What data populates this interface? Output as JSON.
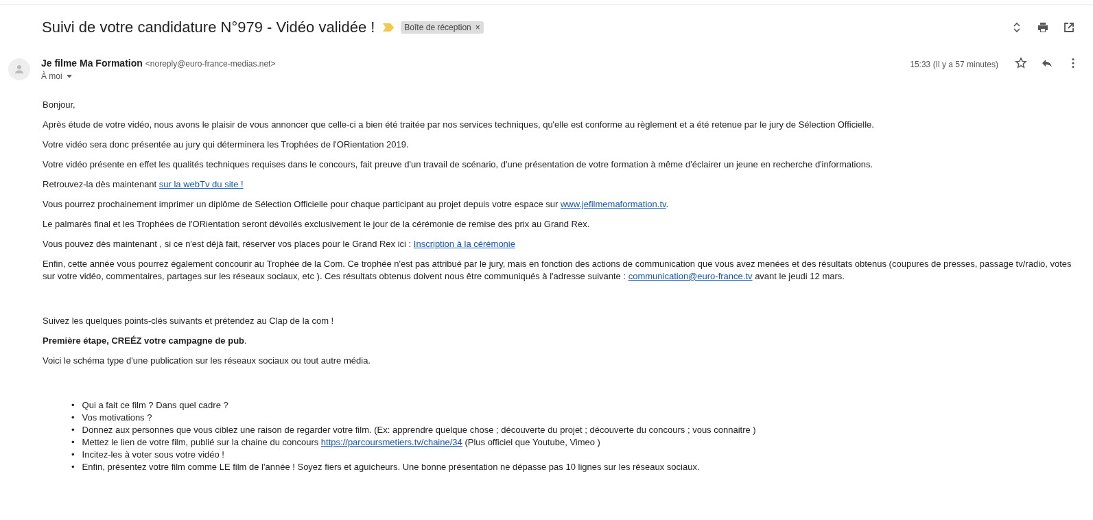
{
  "subject": "Suivi de votre candidature N°979 - Vidéo validée !",
  "important": true,
  "label": {
    "text": "Boîte de réception",
    "close": "×"
  },
  "sender": {
    "name": "Je filme Ma Formation",
    "email": "<noreply@euro-france-medias.net>",
    "to": "À moi",
    "time": "15:33 (Il y a 57 minutes)",
    "starred": false
  },
  "paragraphs": [
    {
      "parts": [
        {
          "kind": "text",
          "text": "Bonjour,"
        }
      ]
    },
    {
      "parts": [
        {
          "kind": "text",
          "text": "Après étude de votre vidéo, nous avons le plaisir de vous annoncer que celle-ci a bien été traitée par nos services techniques, qu'elle est conforme au règlement et a été retenue  par le jury de Sélection Officielle."
        }
      ]
    },
    {
      "parts": [
        {
          "kind": "text",
          "text": "Votre vidéo sera donc  présentée au jury qui déterminera les Trophées de l'ORientation 2019."
        }
      ]
    },
    {
      "parts": [
        {
          "kind": "text",
          "text": "Votre vidéo présente en effet les qualités techniques requises dans le concours, fait preuve d'un travail de scénario, d'une présentation de votre formation à même d'éclairer un jeune en recherche d'informations."
        }
      ]
    },
    {
      "parts": [
        {
          "kind": "text",
          "text": "Retrouvez-la dès maintenant "
        },
        {
          "kind": "link",
          "text": "sur la webTv du site !"
        }
      ]
    },
    {
      "parts": [
        {
          "kind": "text",
          "text": "Vous pourrez prochainement imprimer un diplôme de Sélection Officielle pour chaque participant  au projet  depuis votre espace sur "
        },
        {
          "kind": "link",
          "text": "www.jefilmemaformation.tv"
        },
        {
          "kind": "text",
          "text": "."
        }
      ]
    },
    {
      "parts": [
        {
          "kind": "text",
          "text": "Le palmarès final et les Trophées de l'ORientation  seront dévoilés exclusivement le jour de la cérémonie de remise des prix au Grand Rex."
        }
      ]
    },
    {
      "parts": [
        {
          "kind": "text",
          "text": "Vous pouvez dès maintenant , si ce n'est déjà fait,  réserver vos places pour le Grand Rex ici : "
        },
        {
          "kind": "link",
          "text": "Inscription à la cérémonie"
        }
      ]
    },
    {
      "parts": [
        {
          "kind": "text",
          "text": "Enfin, cette année vous pourrez également concourir au Trophée de la Com. Ce trophée n'est pas attribué par le jury, mais en fonction des actions de communication que vous avez menées et des résultats obtenus (coupures de presses, passage tv/radio, votes sur votre vidéo, commentaires, partages sur les réseaux sociaux, etc ). Ces résultats obtenus doivent nous être communiqués à l'adresse suivante : "
        },
        {
          "kind": "link",
          "text": "communication@euro-france.tv"
        },
        {
          "kind": "text",
          "text": " avant le jeudi 12 mars."
        }
      ]
    }
  ],
  "paragraphs_2": [
    {
      "parts": [
        {
          "kind": "text",
          "text": "Suivez les quelques points-clés suivants et prétendez au Clap de la com !"
        }
      ]
    },
    {
      "parts": [
        {
          "kind": "text",
          "text": "**Première étape, CREÉZ votre campagne de pub**."
        }
      ]
    },
    {
      "parts": [
        {
          "kind": "text",
          "text": "Voici le schéma type d'une publication sur les réseaux sociaux ou tout autre média."
        }
      ]
    }
  ],
  "bullets": [
    {
      "marker": "•",
      "parts": [
        {
          "kind": "text",
          "text": "Qui a fait ce film ? Dans quel cadre ?"
        }
      ]
    },
    {
      "marker": "•",
      "parts": [
        {
          "kind": "text",
          "text": "Vos motivations ?"
        }
      ]
    },
    {
      "marker": "•",
      "parts": [
        {
          "kind": "text",
          "text": "Donnez aux personnes que vous ciblez une raison de regarder votre film. (Ex: apprendre quelque chose ; découverte du projet ; découverte du concours ; vous connaitre )"
        }
      ]
    },
    {
      "marker": "•",
      "parts": [
        {
          "kind": "text",
          "text": "Mettez le lien de votre film, publié sur la chaine du concours "
        },
        {
          "kind": "link",
          "text": "https://parcoursmetiers.tv/chaine/34"
        },
        {
          "kind": "text",
          "text": "  (Plus officiel que Youtube, Vimeo )"
        }
      ]
    },
    {
      "marker": "•",
      "parts": [
        {
          "kind": "text",
          "text": "Incitez-les à voter sous votre vidéo !"
        }
      ]
    },
    {
      "marker": "•",
      "parts": [
        {
          "kind": "text",
          "text": "Enfin, présentez votre film comme LE film de l'année ! Soyez fiers et aguicheurs. Une bonne présentation ne dépasse pas 10 lignes sur les réseaux sociaux."
        }
      ]
    }
  ]
}
